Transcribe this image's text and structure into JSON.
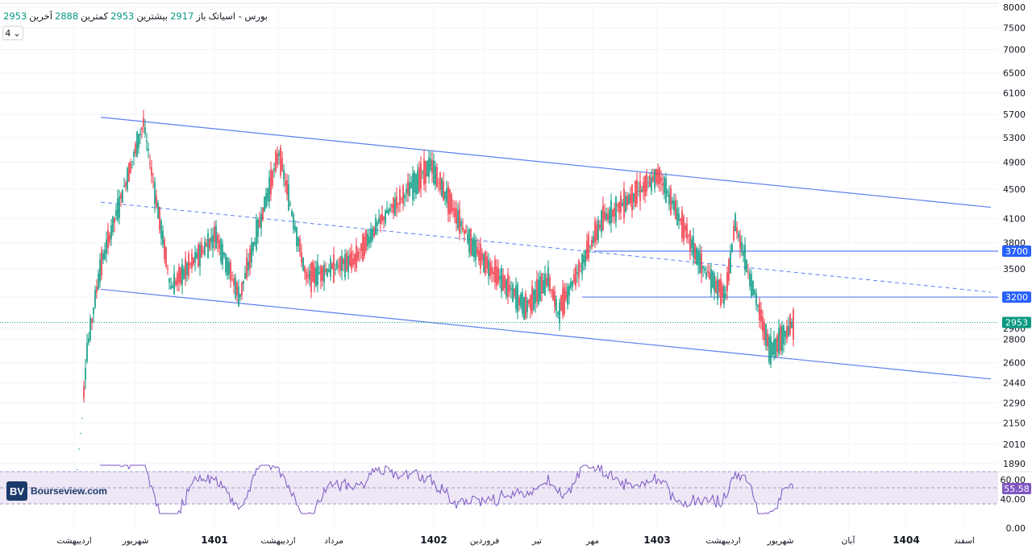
{
  "legend": {
    "symbol": "بورس - اسیاتک",
    "open_label": "باز",
    "open": "2917",
    "high_label": "بیشترین",
    "high": "2953",
    "low_label": "کمترین",
    "low": "2888",
    "close_label": "آخرین",
    "close": "2953"
  },
  "collapse_button": {
    "count": "4"
  },
  "watermark": {
    "mark": "BV",
    "text": "Bourseview.com"
  },
  "colors": {
    "up": "#089981",
    "down": "#f23645",
    "trendline": "#5b7ff0",
    "rsi": "#7e57c2",
    "band": "#ede7f6",
    "last": "#089981"
  },
  "chart_data": {
    "type": "candlestick",
    "price_axis": {
      "ticks": [
        8000,
        7500,
        7000,
        6500,
        6100,
        5700,
        5300,
        4900,
        4500,
        4100,
        3800,
        3500,
        3200,
        2900,
        2800,
        2600,
        2440,
        2290,
        2150,
        2010,
        1890
      ],
      "scale": "log"
    },
    "time_axis": {
      "labels": [
        "اردیبهشت",
        "شهریور",
        "1401",
        "اردیبهشت",
        "مرداد",
        "1402",
        "فروردین",
        "تیر",
        "مهر",
        "1403",
        "اردیبهشت",
        "شهریور",
        "آبان",
        "1404",
        "اسفند"
      ],
      "bold": [
        "1401",
        "1402",
        "1403",
        "1404"
      ]
    },
    "last_price": "2953",
    "horizontal_levels": [
      "3700",
      "3200"
    ],
    "approx_swings": [
      {
        "t": "1400-01",
        "price": 1850
      },
      {
        "t": "1400-03",
        "price": 2700
      },
      {
        "t": "1400-04",
        "price": 3500
      },
      {
        "t": "1400-05",
        "price": 5550
      },
      {
        "t": "1400-07",
        "price": 3300
      },
      {
        "t": "1400-10",
        "price": 3900
      },
      {
        "t": "1400-12",
        "price": 3200
      },
      {
        "t": "1401-03",
        "price": 5050
      },
      {
        "t": "1401-06",
        "price": 3400
      },
      {
        "t": "1401-10",
        "price": 3600
      },
      {
        "t": "1401-12",
        "price": 4050
      },
      {
        "t": "1402-02",
        "price": 4850
      },
      {
        "t": "1402-04",
        "price": 3700
      },
      {
        "t": "1402-06",
        "price": 3100
      },
      {
        "t": "1402-07",
        "price": 3400
      },
      {
        "t": "1402-09",
        "price": 3050
      },
      {
        "t": "1402-11",
        "price": 4100
      },
      {
        "t": "1403-01",
        "price": 4700
      },
      {
        "t": "1403-03",
        "price": 3500
      },
      {
        "t": "1403-04",
        "price": 3200
      },
      {
        "t": "1403-05",
        "price": 4050
      },
      {
        "t": "1403-06",
        "price": 2700
      },
      {
        "t": "1403-07",
        "price": 2953
      }
    ],
    "rsi": {
      "ticks": [
        "60.00",
        "40.00",
        "0.00"
      ],
      "value": "55.58"
    }
  }
}
